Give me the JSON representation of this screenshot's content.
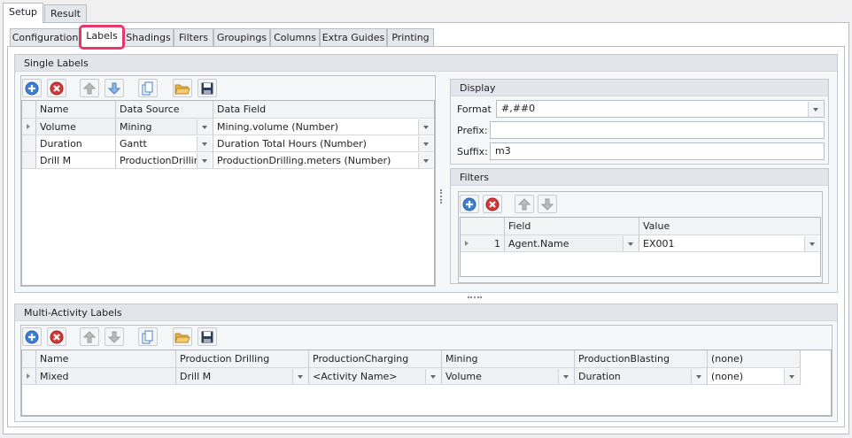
{
  "top_tabs": [
    "Setup",
    "Result"
  ],
  "sub_tabs": [
    "Configuration",
    "Labels",
    "Shadings",
    "Filters",
    "Groupings",
    "Columns",
    "Extra Guides",
    "Printing"
  ],
  "single_labels": {
    "title": "Single Labels",
    "columns": [
      "Name",
      "Data Source",
      "Data Field"
    ],
    "rows": [
      [
        "Volume",
        "Mining",
        "Mining.volume (Number)"
      ],
      [
        "Duration",
        "Gantt",
        "Duration Total Hours (Number)"
      ],
      [
        "Drill M",
        "ProductionDrilling",
        "ProductionDrilling.meters (Number)"
      ]
    ]
  },
  "display": {
    "title": "Display",
    "format_label": "Format",
    "format_value": "#,##0",
    "prefix_label": "Prefix:",
    "prefix_value": "",
    "suffix_label": "Suffix:",
    "suffix_value": "m3"
  },
  "filters": {
    "title": "Filters",
    "columns": [
      "Field",
      "Value"
    ],
    "rows": [
      {
        "num": "1",
        "field": "Agent.Name",
        "value": "EX001"
      }
    ]
  },
  "multi_labels": {
    "title": "Multi-Activity Labels",
    "columns": [
      "Name",
      "Production Drilling",
      "ProductionCharging",
      "Mining",
      "ProductionBlasting",
      "(none)"
    ],
    "rows": [
      [
        "Mixed",
        "Drill M",
        "<Activity Name>",
        "Volume",
        "Duration",
        "(none)"
      ]
    ]
  },
  "colors": {
    "highlight": "#e8386a",
    "add": "#3d7fd6",
    "delete": "#d23a3a"
  }
}
